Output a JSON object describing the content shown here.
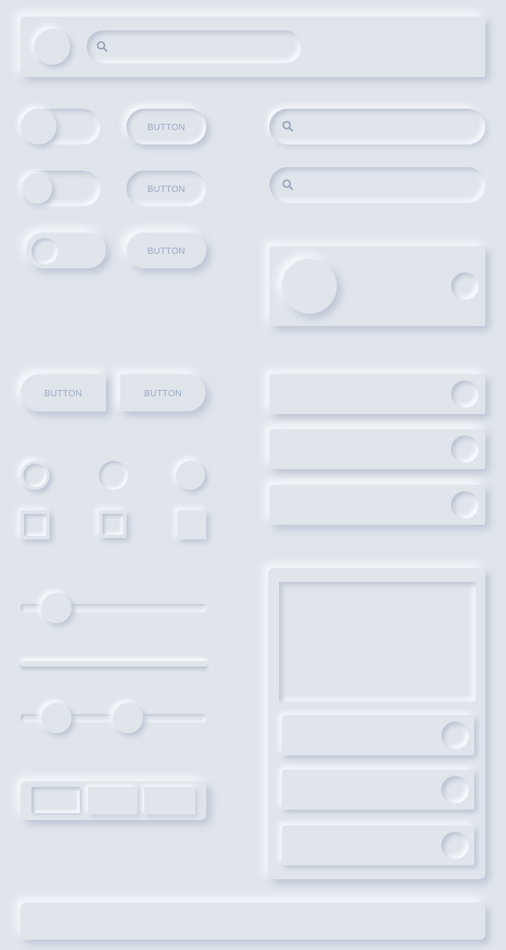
{
  "header": {
    "search": {
      "placeholder": "",
      "value": ""
    }
  },
  "buttons": {
    "button_1": "BUTTON",
    "button_2": "BUTTON",
    "button_3": "BUTTON",
    "segment_left": "BUTTON",
    "segment_right": "BUTTON"
  },
  "search_fields": [
    {
      "placeholder": "",
      "value": ""
    },
    {
      "placeholder": "",
      "value": ""
    }
  ],
  "toggles": [
    {
      "state": "on"
    },
    {
      "state": "off"
    },
    {
      "state": "off-inset"
    }
  ],
  "sliders": {
    "single": {
      "value": 0.19
    },
    "range": {
      "low": 0.19,
      "high": 0.58
    }
  },
  "tabs": {
    "selected_index": 0,
    "count": 3
  },
  "colors": {
    "background": "#e0e5ec",
    "shadow_dark": "#bcc4d2",
    "shadow_light": "#fafcff",
    "label": "#9aa8c0",
    "icon": "#98a4b8"
  }
}
